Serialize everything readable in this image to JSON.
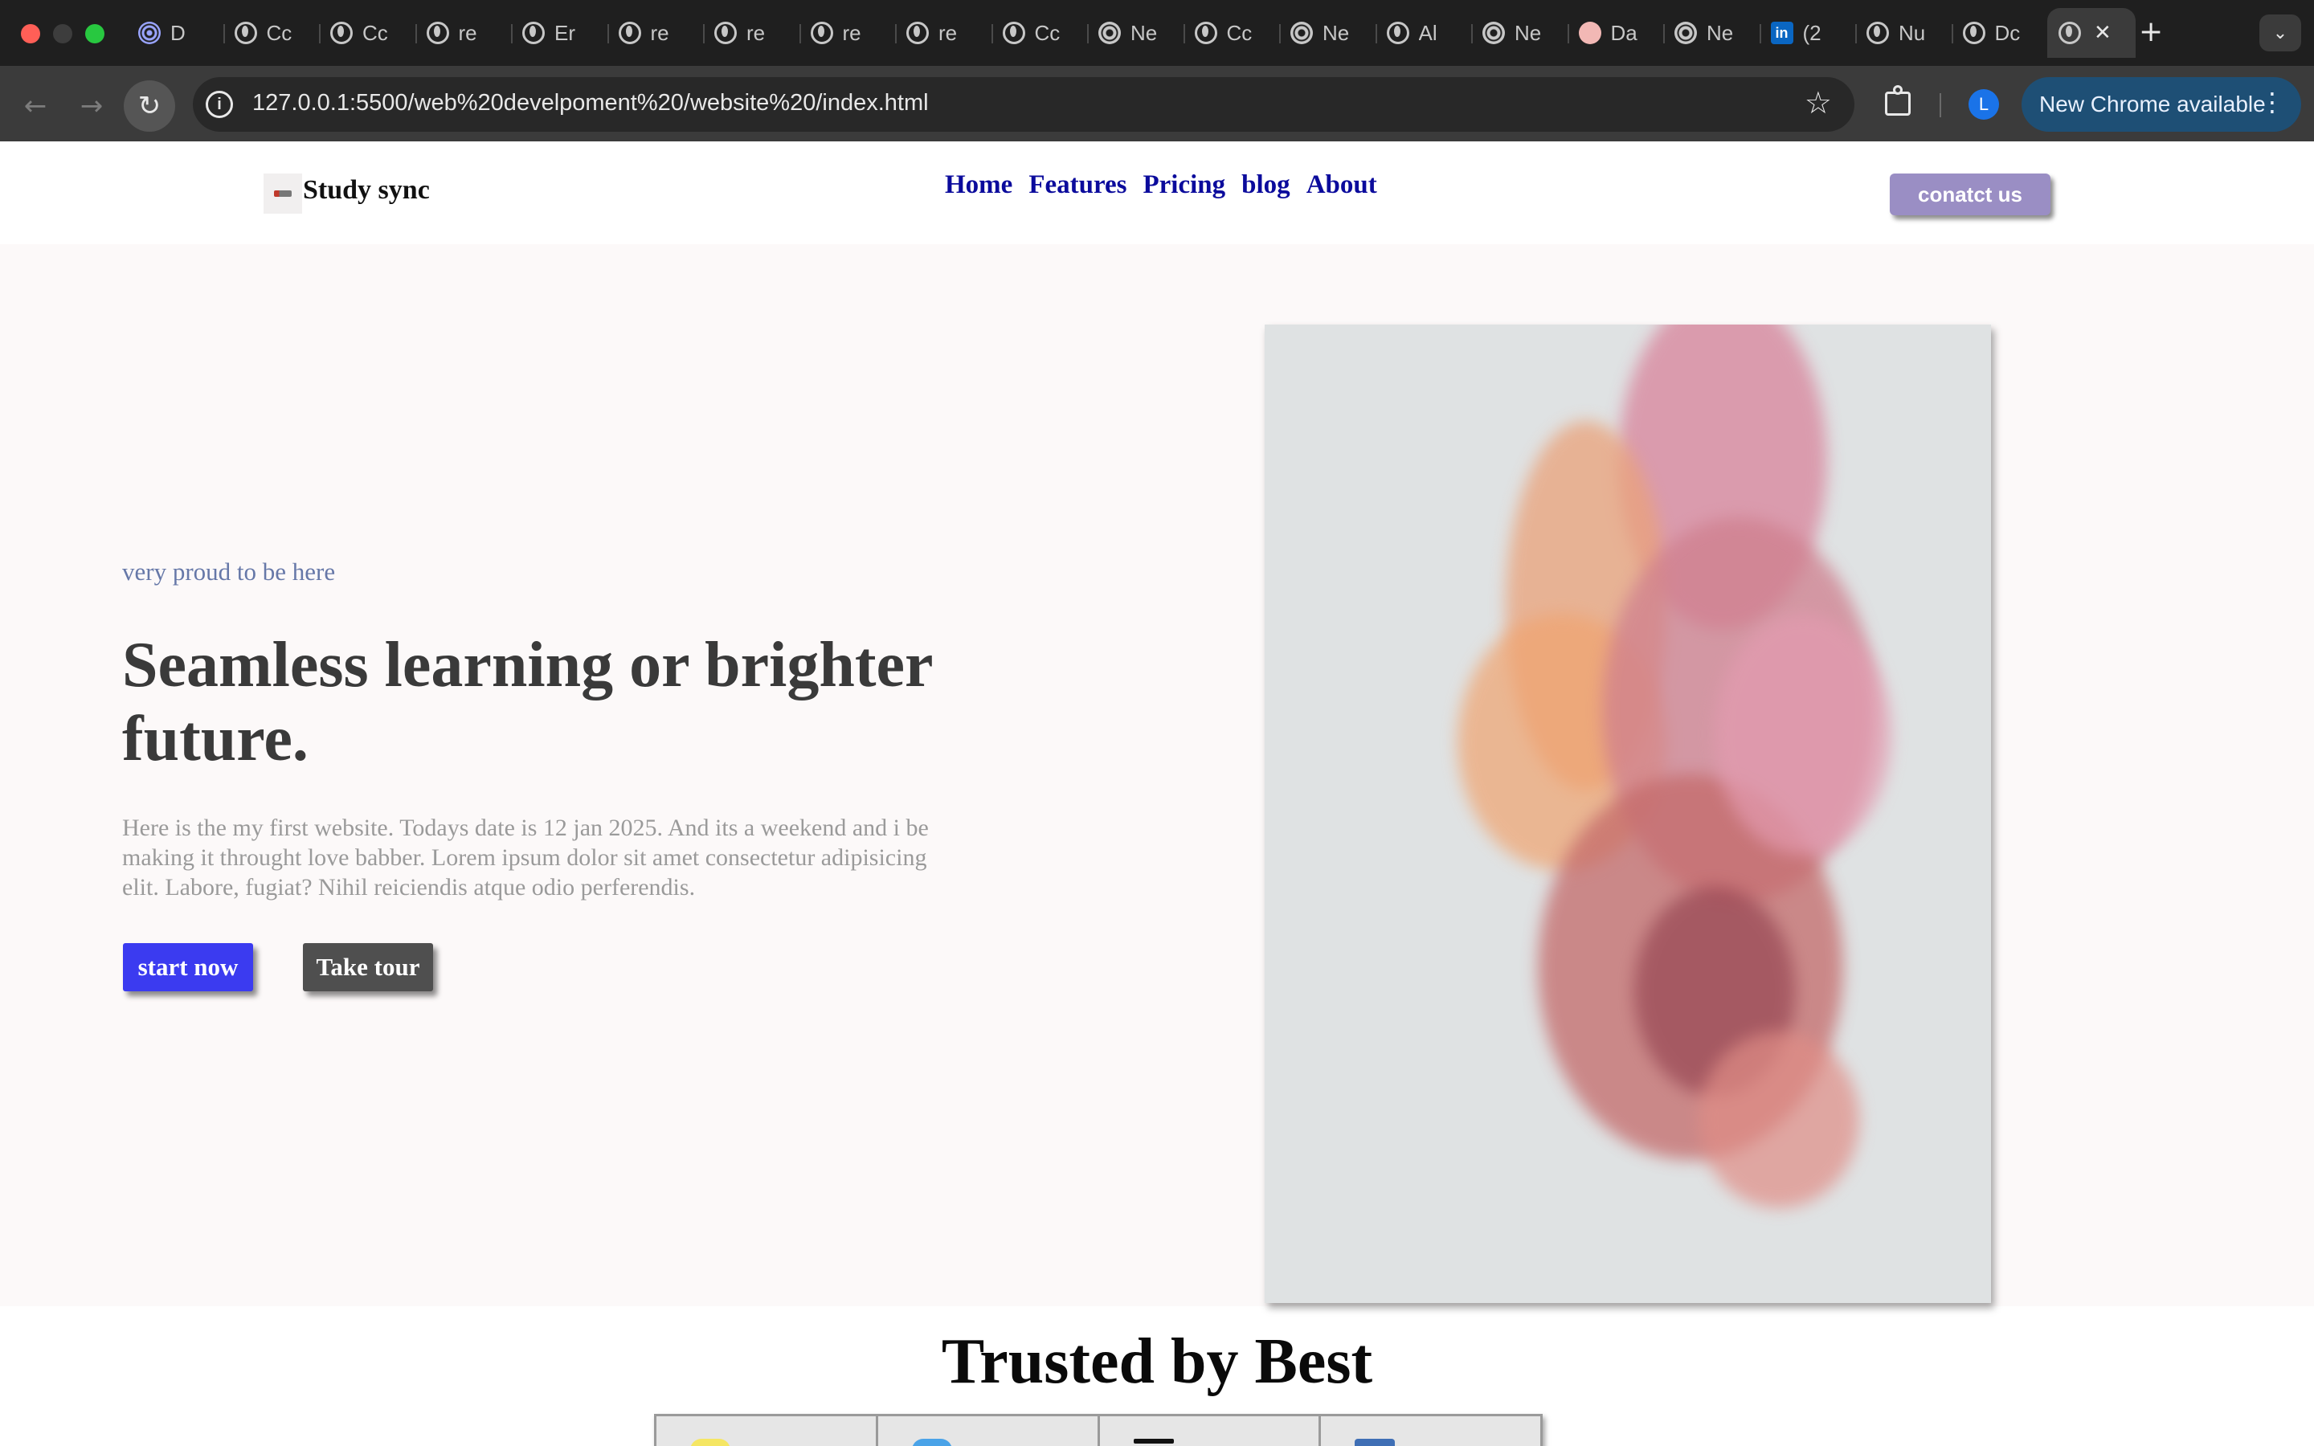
{
  "browser": {
    "tabs": [
      {
        "title": "D",
        "icon": "target-icon"
      },
      {
        "title": "Cc",
        "icon": "globe-icon"
      },
      {
        "title": "Cc",
        "icon": "globe-icon"
      },
      {
        "title": "re",
        "icon": "globe-icon"
      },
      {
        "title": "Er",
        "icon": "globe-icon"
      },
      {
        "title": "re",
        "icon": "globe-icon"
      },
      {
        "title": "re",
        "icon": "globe-icon"
      },
      {
        "title": "re",
        "icon": "globe-icon"
      },
      {
        "title": "re",
        "icon": "globe-icon"
      },
      {
        "title": "Cc",
        "icon": "globe-icon"
      },
      {
        "title": "Ne",
        "icon": "chrome-icon"
      },
      {
        "title": "Cc",
        "icon": "globe-icon"
      },
      {
        "title": "Ne",
        "icon": "chrome-icon"
      },
      {
        "title": "Al",
        "icon": "globe-icon"
      },
      {
        "title": "Ne",
        "icon": "chrome-icon"
      },
      {
        "title": "Da",
        "icon": "face-icon"
      },
      {
        "title": "Ne",
        "icon": "chrome-icon"
      },
      {
        "title": "(2",
        "icon": "linkedin-icon"
      },
      {
        "title": "Nu",
        "icon": "globe-icon"
      },
      {
        "title": "Dc",
        "icon": "globe-icon"
      }
    ],
    "active_tab_close": "✕",
    "new_tab": "+",
    "tab_search": "⌄",
    "address": "127.0.0.1:5500/web%20develpoment%20/website%20/index.html",
    "profile_initial": "L",
    "update_chip": "New Chrome available",
    "info_glyph": "i",
    "star_glyph": "☆",
    "back_glyph": "←",
    "forward_glyph": "→",
    "reload_glyph": "↻",
    "menu_glyph": "⋮"
  },
  "site": {
    "logo_text": "Study sync",
    "nav": [
      "Home",
      "Features",
      "Pricing",
      "blog",
      "About"
    ],
    "contact_label": "conatct us",
    "hero": {
      "tagline": "very proud to be here",
      "headline": "Seamless learning or brighter future.",
      "description": "Here is the my first website. Todays date is 12 jan 2025. And its a weekend and i be making it throught love babber. Lorem ipsum dolor sit amet consectetur adipisicing elit. Labore, fugiat? Nihil reiciendis atque odio perferendis.",
      "start_label": "start now",
      "tour_label": "Take tour"
    },
    "trusted_heading": "Trusted by Best"
  },
  "colors": {
    "accent_blue": "#3b3bf0",
    "nav_link": "#0b0b9c",
    "contact_button": "#9a8ec4",
    "chrome_update": "#1e4f75"
  }
}
